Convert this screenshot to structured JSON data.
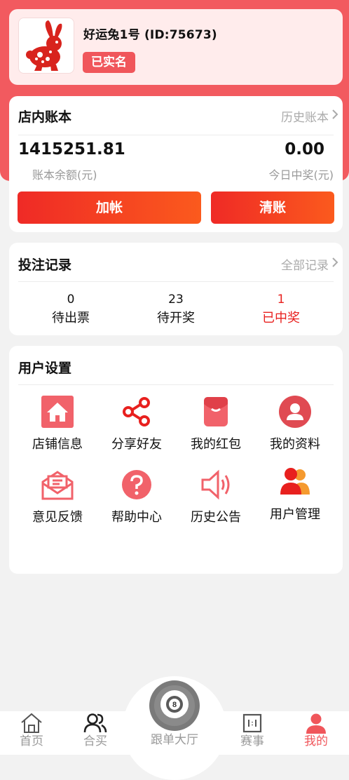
{
  "profile": {
    "username": "好运兔1号 (ID:75673)",
    "badge": "已实名"
  },
  "account": {
    "title": "店内账本",
    "history_link": "历史账本",
    "balance": "1415251.81",
    "balance_label": "账本余额(元)",
    "today_win": "0.00",
    "today_win_label": "今日中奖(元)",
    "add_button": "加帐",
    "clear_button": "清账"
  },
  "bets": {
    "title": "投注记录",
    "all_link": "全部记录",
    "stats": [
      {
        "count": "0",
        "label": "待出票"
      },
      {
        "count": "23",
        "label": "待开奖"
      },
      {
        "count": "1",
        "label": "已中奖"
      }
    ]
  },
  "settings": {
    "title": "用户设置",
    "items": [
      {
        "label": "店铺信息",
        "icon": "store-icon"
      },
      {
        "label": "分享好友",
        "icon": "share-icon"
      },
      {
        "label": "我的红包",
        "icon": "red-packet-icon"
      },
      {
        "label": "我的资料",
        "icon": "profile-icon"
      },
      {
        "label": "意见反馈",
        "icon": "feedback-icon"
      },
      {
        "label": "帮助中心",
        "icon": "help-icon"
      },
      {
        "label": "历史公告",
        "icon": "announcement-icon"
      },
      {
        "label": "用户管理",
        "icon": "user-management-icon"
      }
    ]
  },
  "tabbar": {
    "items": [
      {
        "label": "首页",
        "icon": "home-icon"
      },
      {
        "label": "合买",
        "icon": "group-buy-icon"
      },
      {
        "label": "跟单大厅",
        "icon": "billiard-ball-icon"
      },
      {
        "label": "赛事",
        "icon": "scoreboard-icon"
      },
      {
        "label": "我的",
        "icon": "user-icon"
      }
    ],
    "active": "我的"
  },
  "colors": {
    "primary": "#f0565b",
    "button_start": "#ef2a26",
    "button_end": "#fb5a1d",
    "win_red": "#e8201e"
  }
}
